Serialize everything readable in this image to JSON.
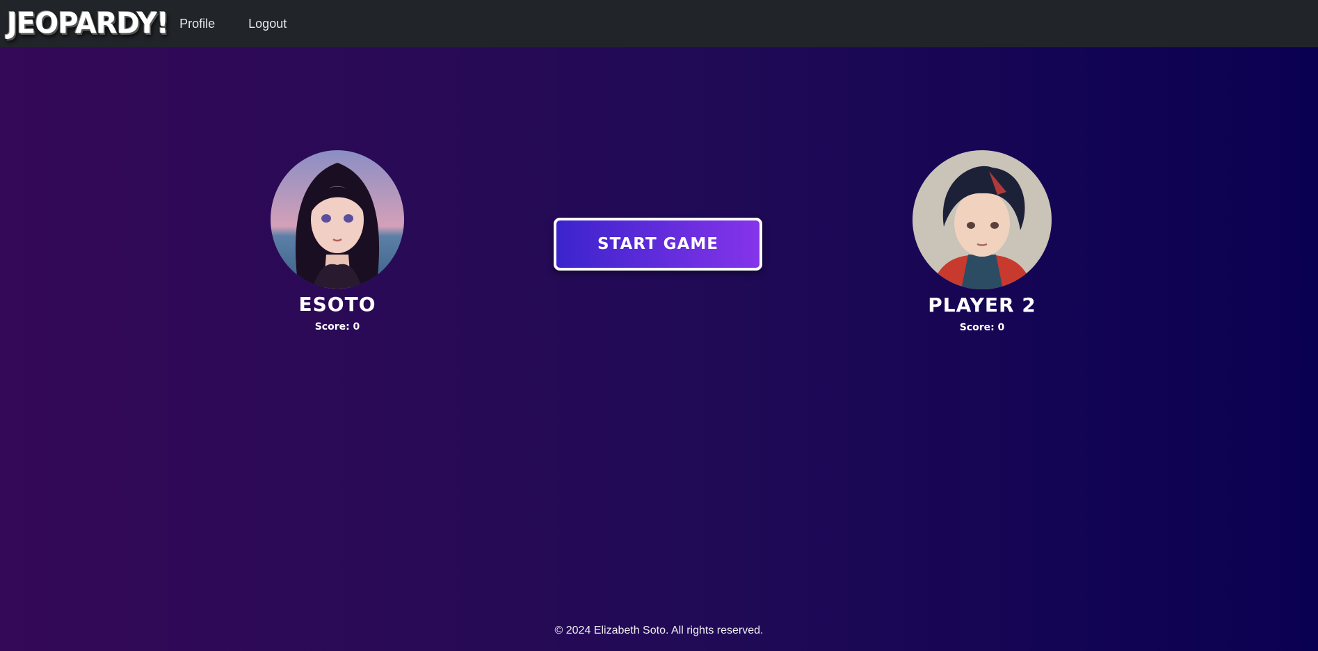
{
  "navbar": {
    "brand": "JEOPARDY!",
    "links": [
      "Profile",
      "Logout"
    ]
  },
  "players": [
    {
      "name": "ESOTO",
      "score_text": "Score: 0"
    },
    {
      "name": "PLAYER 2",
      "score_text": "Score: 0"
    }
  ],
  "start_button": {
    "label": "START GAME"
  },
  "footer": {
    "text": "© 2024 Elizabeth Soto. All rights reserved."
  },
  "colors": {
    "navbar_bg": "#212529",
    "bg_left": "#340957",
    "bg_right": "#0a0052",
    "button_left": "#3b24cc",
    "button_right": "#8534ea"
  }
}
